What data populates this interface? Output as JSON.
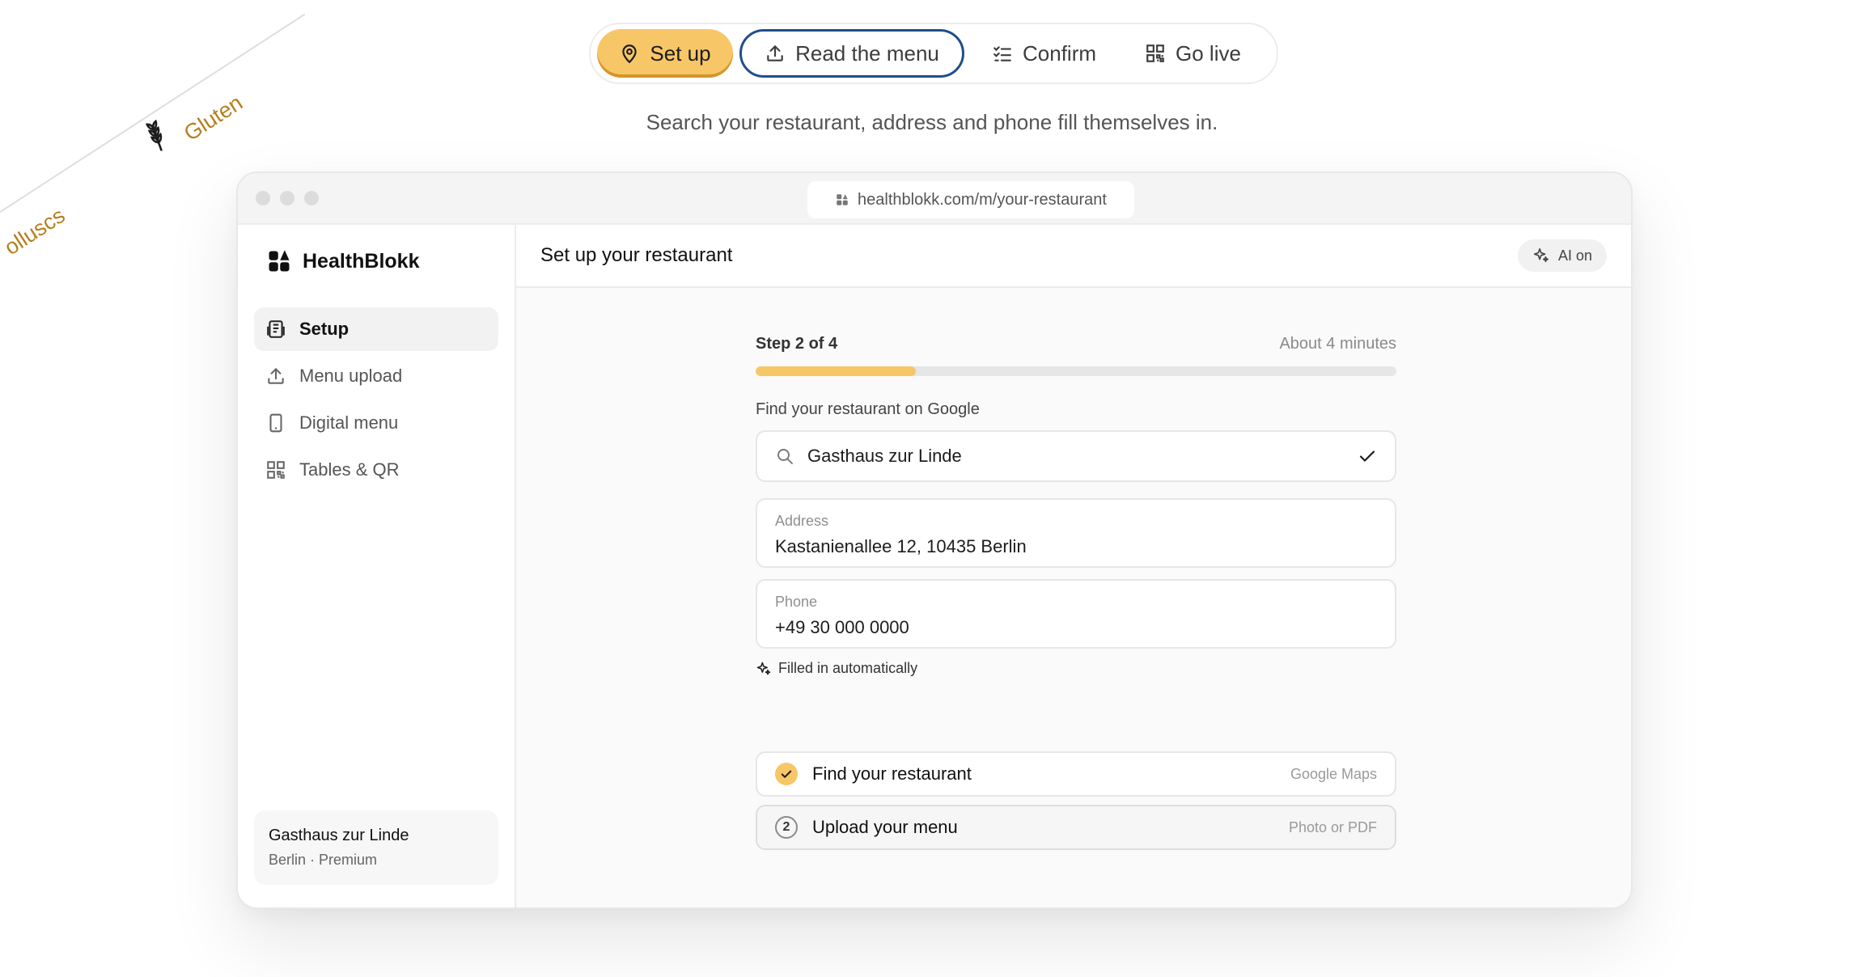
{
  "ribbon": {
    "allergen_1": "Gluten",
    "allergen_2": "olluscs"
  },
  "stepper": {
    "steps": [
      {
        "label": "Set up",
        "icon": "map-pin-icon"
      },
      {
        "label": "Read the menu",
        "icon": "upload-icon"
      },
      {
        "label": "Confirm",
        "icon": "checklist-icon"
      },
      {
        "label": "Go live",
        "icon": "qr-code-icon"
      }
    ],
    "active_index": 0
  },
  "subtitle": "Search your restaurant, address and phone fill themselves in.",
  "browser": {
    "url": "healthblokk.com/m/your-restaurant"
  },
  "sidebar": {
    "brand": "HealthBlokk",
    "items": [
      {
        "label": "Setup",
        "icon": "clipboard-icon"
      },
      {
        "label": "Menu upload",
        "icon": "upload-icon"
      },
      {
        "label": "Digital menu",
        "icon": "phone-icon"
      },
      {
        "label": "Tables & QR",
        "icon": "qr-code-icon"
      }
    ],
    "account": {
      "name": "Gasthaus zur Linde",
      "meta": "Berlin · Premium"
    }
  },
  "main": {
    "title": "Set up your restaurant",
    "ai_badge": "AI on",
    "step_label": "Step 2 of 4",
    "time_estimate": "About 4 minutes",
    "progress": 0.25,
    "search_label": "Find your restaurant on Google",
    "search_value": "Gasthaus zur Linde",
    "address_label": "Address",
    "address_value": "Kastanienallee 12, 10435 Berlin",
    "phone_label": "Phone",
    "phone_value": "+49 30 000 0000",
    "auto_note": "Filled in automatically",
    "tasks": [
      {
        "label": "Find your restaurant",
        "hint": "Google Maps",
        "status": "done"
      },
      {
        "label": "Upload your menu",
        "hint": "Photo or PDF",
        "status": "current",
        "number": "2"
      }
    ]
  },
  "colors": {
    "accent": "#f7c667",
    "accent_dark": "#d6952b",
    "focus_ring": "#1f4e8c",
    "ribbon_text": "#b5801f"
  }
}
